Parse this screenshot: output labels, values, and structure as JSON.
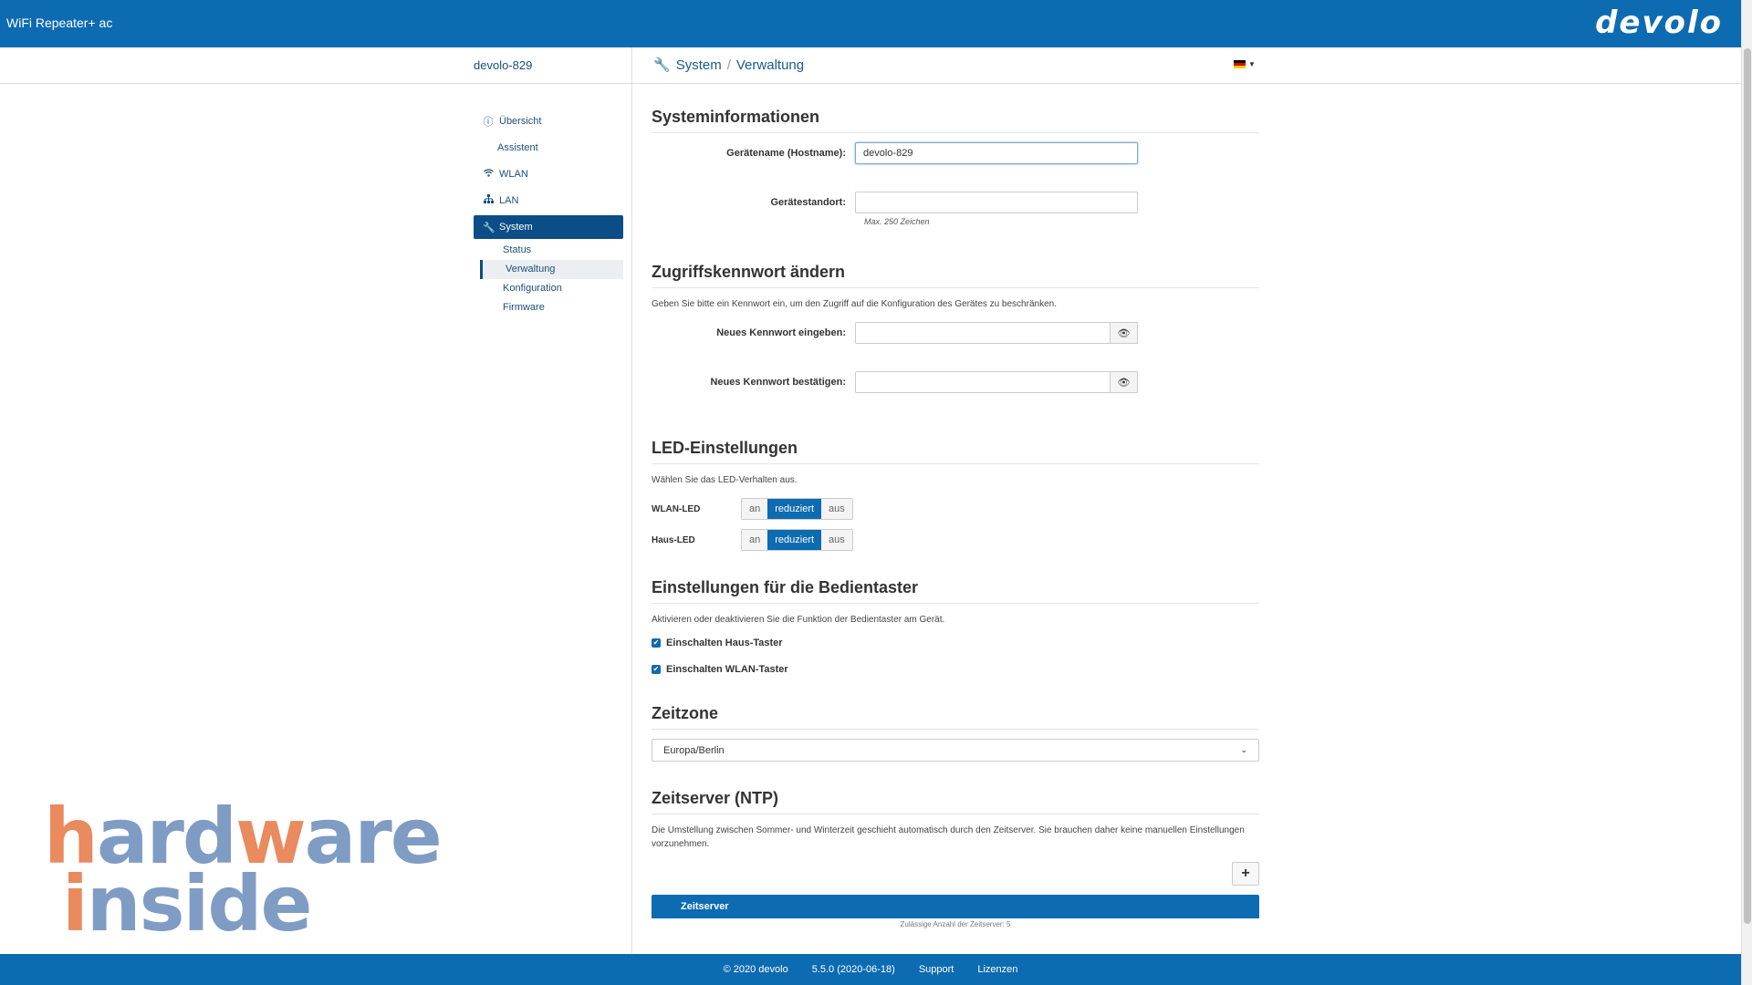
{
  "app": {
    "title": "WiFi Repeater+ ac",
    "logo": "devolo"
  },
  "device": {
    "name": "devolo-829"
  },
  "breadcrumb": {
    "section": "System",
    "separator": "/",
    "page": "Verwaltung"
  },
  "sidebar": {
    "items": [
      {
        "label": "Übersicht",
        "icon": "info-icon"
      },
      {
        "label": "Assistent",
        "icon": ""
      },
      {
        "label": "WLAN",
        "icon": "wifi-icon"
      },
      {
        "label": "LAN",
        "icon": "network-icon"
      },
      {
        "label": "System",
        "icon": "wrench-icon"
      }
    ],
    "subitems": [
      "Status",
      "Verwaltung",
      "Konfiguration",
      "Firmware"
    ]
  },
  "sysinfo": {
    "title": "Systeminformationen",
    "hostname_label": "Gerätename (Hostname):",
    "hostname_value": "devolo-829",
    "location_label": "Gerätestandort:",
    "location_value": "",
    "location_hint": "Max. 250 Zeichen"
  },
  "password": {
    "title": "Zugriffskennwort ändern",
    "desc": "Geben Sie bitte ein Kennwort ein, um den Zugriff auf die Konfiguration des Gerätes zu beschränken.",
    "new_label": "Neues Kennwort eingeben:",
    "confirm_label": "Neues Kennwort bestätigen:"
  },
  "led": {
    "title": "LED-Einstellungen",
    "desc": "Wählen Sie das LED-Verhalten aus.",
    "options": [
      "an",
      "reduziert",
      "aus"
    ],
    "rows": [
      {
        "label": "WLAN-LED",
        "selected": "reduziert"
      },
      {
        "label": "Haus-LED",
        "selected": "reduziert"
      }
    ]
  },
  "buttons": {
    "title": "Einstellungen für die Bedientaster",
    "desc": "Aktivieren oder deaktivieren Sie die Funktion der Bedientaster am Gerät.",
    "haus_label": "Einschalten Haus-Taster",
    "wlan_label": "Einschalten WLAN-Taster",
    "haus_checked": true,
    "wlan_checked": true
  },
  "timezone": {
    "title": "Zeitzone",
    "value": "Europa/Berlin"
  },
  "ntp": {
    "title": "Zeitserver (NTP)",
    "desc": "Die Umstellung zwischen Sommer- und Winterzeit geschieht automatisch durch den Zeitserver. Sie brauchen daher keine manuellen Einstellungen vorzunehmen.",
    "add_symbol": "+",
    "table_header": "Zeitserver",
    "table_note": "Zulässige Anzahl der Zeitserver: 5"
  },
  "footer": {
    "copyright": "© 2020 devolo",
    "version": "5.5.0 (2020-06-18)",
    "support": "Support",
    "licenses": "Lizenzen"
  },
  "watermark": {
    "line1": "hardware",
    "line2": "inside"
  },
  "colors": {
    "primary": "#0d6bb1",
    "dark_nav": "#0b4d86",
    "watermark_orange": "#e98a5f",
    "watermark_blue": "#7f9cc4"
  }
}
